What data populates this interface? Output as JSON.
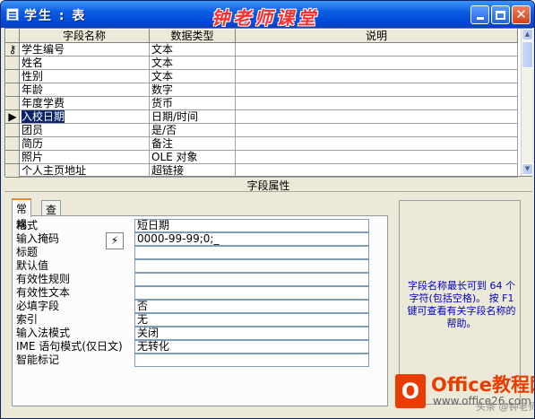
{
  "window": {
    "title": "学生 : 表",
    "brand": "钟老师课堂"
  },
  "grid": {
    "columns": [
      "字段名称",
      "数据类型",
      "说明"
    ],
    "rows": [
      {
        "name": "学生编号",
        "type": "文本",
        "desc": "",
        "key": true
      },
      {
        "name": "姓名",
        "type": "文本",
        "desc": ""
      },
      {
        "name": "性别",
        "type": "文本",
        "desc": ""
      },
      {
        "name": "年龄",
        "type": "数字",
        "desc": ""
      },
      {
        "name": "年度学费",
        "type": "货币",
        "desc": ""
      },
      {
        "name": "入校日期",
        "type": "日期/时间",
        "desc": "",
        "current": true
      },
      {
        "name": "团员",
        "type": "是/否",
        "desc": ""
      },
      {
        "name": "简历",
        "type": "备注",
        "desc": ""
      },
      {
        "name": "照片",
        "type": "OLE 对象",
        "desc": ""
      },
      {
        "name": "个人主页地址",
        "type": "超链接",
        "desc": ""
      }
    ]
  },
  "properties": {
    "section_title": "字段属性",
    "tabs": [
      "常规",
      "查阅"
    ],
    "active_tab": "常规",
    "rows": [
      {
        "label": "格式",
        "value": "短日期"
      },
      {
        "label": "输入掩码",
        "value": "0000-99-99;0;_"
      },
      {
        "label": "标题",
        "value": ""
      },
      {
        "label": "默认值",
        "value": ""
      },
      {
        "label": "有效性规则",
        "value": ""
      },
      {
        "label": "有效性文本",
        "value": ""
      },
      {
        "label": "必填字段",
        "value": "否"
      },
      {
        "label": "索引",
        "value": "无"
      },
      {
        "label": "输入法模式",
        "value": "关闭"
      },
      {
        "label": "IME 语句模式(仅日文)",
        "value": "无转化"
      },
      {
        "label": "智能标记",
        "value": ""
      }
    ],
    "help": "字段名称最长可到 64 个字符(包括空格)。 按 F1 键可查看有关字段名称的帮助。"
  },
  "watermark": {
    "logo": "O",
    "brand": "Office教程网",
    "url": "www.office26.com",
    "source": "头条 @钟老师课堂"
  }
}
